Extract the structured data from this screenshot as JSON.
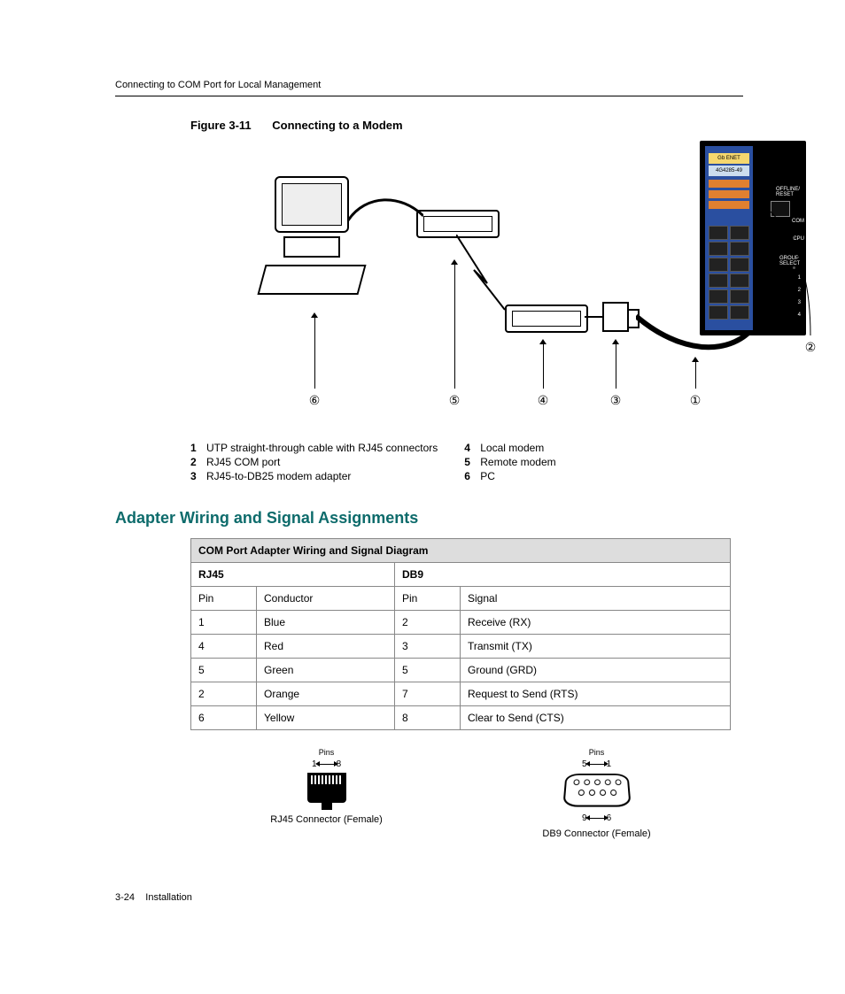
{
  "header": "Connecting to COM Port for Local Management",
  "figure": {
    "number": "Figure 3-11",
    "title": "Connecting to a Modem"
  },
  "switch_labels": {
    "top": "Gb ENET",
    "model": "4G4285-49",
    "offline": "OFFLINE/ RESET",
    "com": "COM",
    "cpu": "CPU",
    "group": "GROUP SELECT",
    "nums": [
      "1",
      "2",
      "3",
      "4"
    ]
  },
  "callouts": {
    "c1": "①",
    "c2": "②",
    "c3": "③",
    "c4": "④",
    "c5": "⑤",
    "c6": "⑥"
  },
  "legend": {
    "l1n": "1",
    "l1": "UTP straight-through cable with RJ45 connectors",
    "l2n": "2",
    "l2": "RJ45 COM port",
    "l3n": "3",
    "l3": "RJ45-to-DB25 modem adapter",
    "l4n": "4",
    "l4": "Local modem",
    "l5n": "5",
    "l5": "Remote modem",
    "l6n": "6",
    "l6": "PC"
  },
  "section_title": "Adapter Wiring and Signal Assignments",
  "table": {
    "title": "COM Port Adapter Wiring and Signal Diagram",
    "rj45": "RJ45",
    "db9": "DB9",
    "h_pin": "Pin",
    "h_conductor": "Conductor",
    "h_signal": "Signal",
    "rows": [
      {
        "rpin": "1",
        "cond": "Blue",
        "dpin": "2",
        "sig": "Receive (RX)"
      },
      {
        "rpin": "4",
        "cond": "Red",
        "dpin": "3",
        "sig": "Transmit (TX)"
      },
      {
        "rpin": "5",
        "cond": "Green",
        "dpin": "5",
        "sig": "Ground (GRD)"
      },
      {
        "rpin": "2",
        "cond": "Orange",
        "dpin": "7",
        "sig": "Request to Send (RTS)"
      },
      {
        "rpin": "6",
        "cond": "Yellow",
        "dpin": "8",
        "sig": "Clear to Send (CTS)"
      }
    ]
  },
  "connectors": {
    "pins_label": "Pins",
    "rj45_left": "1",
    "rj45_right": "8",
    "rj45_caption": "RJ45 Connector (Female)",
    "db9_top_left": "5",
    "db9_top_right": "1",
    "db9_bot_left": "9",
    "db9_bot_right": "6",
    "db9_caption": "DB9  Connector  (Female)"
  },
  "footer": {
    "pagenum": "3-24",
    "section": "Installation"
  }
}
